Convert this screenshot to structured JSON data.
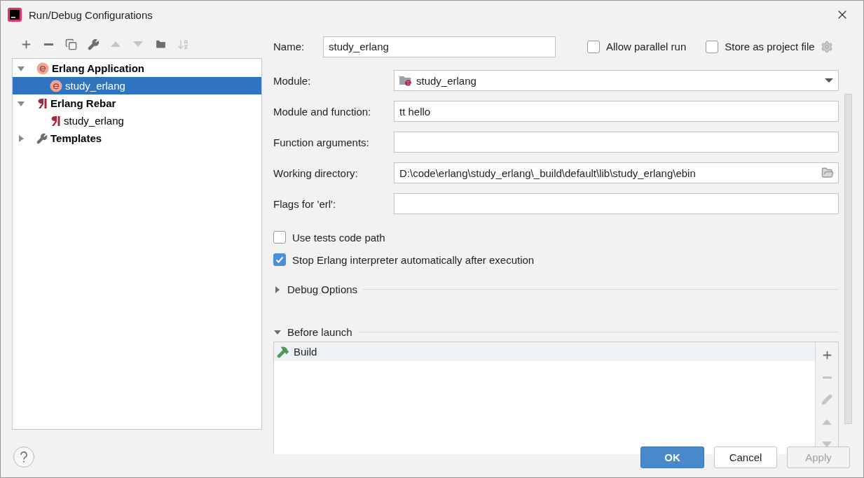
{
  "window": {
    "title": "Run/Debug Configurations"
  },
  "toolbar": [
    {
      "kind": "add",
      "disabled": false
    },
    {
      "kind": "remove",
      "disabled": false
    },
    {
      "kind": "copy",
      "disabled": false
    },
    {
      "kind": "edit",
      "disabled": false
    },
    {
      "kind": "up",
      "disabled": true
    },
    {
      "kind": "down",
      "disabled": true
    },
    {
      "kind": "folder",
      "disabled": false
    },
    {
      "kind": "sort",
      "disabled": true
    }
  ],
  "tree": [
    {
      "label": "Erlang Application",
      "kind": "erlang",
      "expanded": true,
      "selected": false,
      "children": [
        {
          "label": "study_erlang",
          "kind": "erlang",
          "selected": true
        }
      ]
    },
    {
      "label": "Erlang Rebar",
      "kind": "rebar",
      "expanded": true,
      "selected": false,
      "children": [
        {
          "label": "study_erlang",
          "kind": "rebar",
          "selected": false
        }
      ]
    },
    {
      "label": "Templates",
      "kind": "wrench",
      "expanded": false,
      "selected": false
    }
  ],
  "name": {
    "label": "Name:",
    "value": "study_erlang"
  },
  "options": [
    {
      "label": "Allow parallel run",
      "checked": false
    },
    {
      "label": "Store as project file",
      "checked": false
    }
  ],
  "fields": [
    {
      "label": "Module:",
      "kind": "module",
      "value": "study_erlang"
    },
    {
      "label": "Module and function:",
      "kind": "text",
      "value": "tt hello"
    },
    {
      "label": "Function arguments:",
      "kind": "text"
    },
    {
      "label": "Working directory:",
      "kind": "folder",
      "value": "D:\\code\\erlang\\study_erlang\\_build\\default\\lib\\study_erlang\\ebin"
    },
    {
      "label": "Flags for 'erl':",
      "kind": "text"
    }
  ],
  "checks": [
    {
      "label": "Use tests code path",
      "checked": false
    },
    {
      "label": "Stop Erlang interpreter automatically after execution",
      "checked": true
    }
  ],
  "sections": [
    {
      "label": "Debug Options",
      "expanded": false
    },
    {
      "label": "Before launch",
      "expanded": true
    }
  ],
  "before_launch": {
    "tasks": [
      {
        "label": "Build",
        "selected": true
      }
    ],
    "tools": [
      {
        "kind": "add",
        "disabled": false
      },
      {
        "kind": "remove",
        "disabled": true
      },
      {
        "kind": "edit",
        "disabled": true
      },
      {
        "kind": "up",
        "disabled": true
      },
      {
        "kind": "down",
        "disabled": true
      }
    ]
  },
  "buttons": [
    {
      "label": "OK",
      "kind": "primary",
      "disabled": false
    },
    {
      "label": "Cancel",
      "kind": "normal",
      "disabled": false
    },
    {
      "label": "Apply",
      "kind": "normal",
      "disabled": true
    }
  ]
}
